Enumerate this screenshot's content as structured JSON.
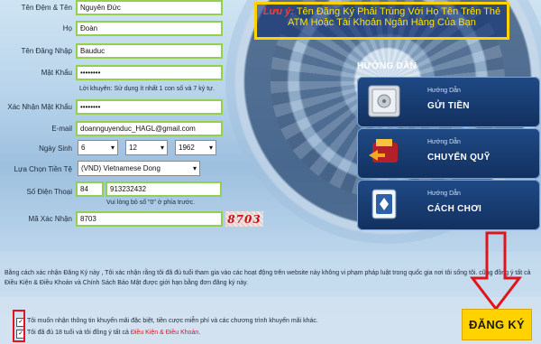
{
  "form": {
    "fields": [
      {
        "label": "Tên Đệm & Tên",
        "value": "Nguyên Đức"
      },
      {
        "label": "Họ",
        "value": "Đoàn"
      },
      {
        "label": "Tên Đăng Nhập",
        "value": "Bauduc"
      },
      {
        "label": "Mật Khẩu",
        "value": "••••••••"
      },
      {
        "label": "Xác Nhận Mật Khẩu",
        "value": "••••••••"
      },
      {
        "label": "E-mail",
        "value": "doannguyenduc_HAGL@gmail.com"
      }
    ],
    "password_hint": "Lời khuyên: Sử dụng ít nhất 1 con số và 7 ký tự.",
    "birthdate": {
      "label": "Ngày Sinh",
      "day": "6",
      "month": "12",
      "year": "1962"
    },
    "currency": {
      "label": "Lựa Chọn Tiền Tệ",
      "value": "(VND) Vietnamese Dong"
    },
    "phone": {
      "label": "Số Điện Thoại",
      "code": "84",
      "number": "913232432",
      "hint": "Vui lòng bỏ số \"0\" ở phía trước."
    },
    "captcha": {
      "label": "Mã Xác Nhận",
      "value": "8703",
      "image_text": "8703"
    }
  },
  "notice": {
    "prefix": "Lưu ý:",
    "text": "Tên Đăng Ký Phải Trùng Với Họ Tên Trên Thẻ ATM Hoặc Tài Khoản Ngân Hàng Của Bạn"
  },
  "guide": {
    "title": "HƯỚNG DẪN",
    "cards": [
      {
        "subtitle": "Hướng Dẫn",
        "title": "GỬI TIỀN",
        "icon": "safe-icon"
      },
      {
        "subtitle": "Hướng Dẫn",
        "title": "CHUYỂN QUỸ",
        "icon": "wallet-transfer-icon"
      },
      {
        "subtitle": "Hướng Dẫn",
        "title": "CÁCH CHƠI",
        "icon": "playing-card-icon"
      }
    ]
  },
  "terms": {
    "text": "Bằng cách xác nhận Đăng Ký này , Tôi xác nhận rằng tôi đã đủ tuổi tham gia vào các hoạt động trên website này không vi phạm pháp luật trong quốc gia nơi tôi sống tôi. cũng đồng ý tất cả Điều Kiện & Điều Khoản và Chính Sách Bảo Mật được giới hạn bằng đơn đăng ký này."
  },
  "checkboxes": {
    "promo": "Tôi muốn nhận thông tin khuyến mãi đặc biệt, tiền cược miễn phí và các chương trình khuyến mãi khác.",
    "age_prefix": "Tôi đã đủ 18 tuổi và tôi đồng ý tất cả",
    "age_link": "Điều Kiện & Điều Khoản",
    "age_suffix": "."
  },
  "register_button": "ĐĂNG KÝ",
  "colors": {
    "field_border": "#92d050",
    "accent_yellow": "#ffd200",
    "red": "#e0141b",
    "card_bg": "#1f4a86"
  }
}
